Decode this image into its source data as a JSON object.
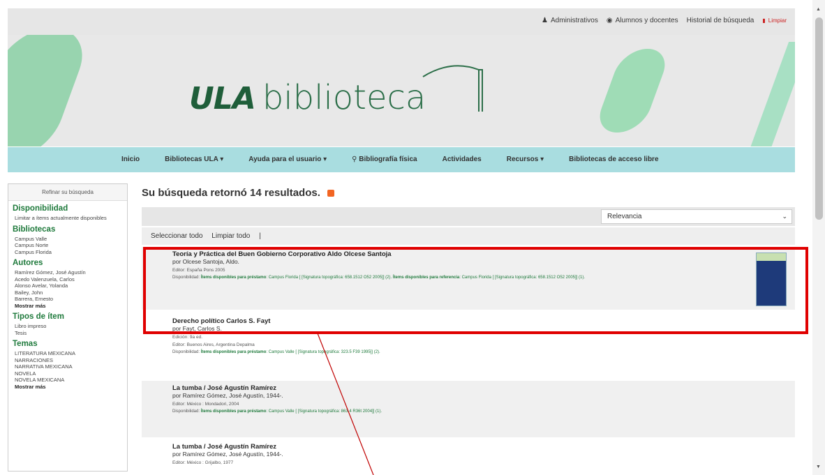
{
  "topbar": {
    "admin": "Administrativos",
    "students": "Alumnos y docentes",
    "history": "Historial de búsqueda",
    "clear": "Limpiar"
  },
  "banner": {
    "logo_mark": "ULA",
    "logo_text": "biblioteca"
  },
  "nav": [
    {
      "label": "Inicio"
    },
    {
      "label": "Bibliotecas ULA ▾"
    },
    {
      "label": "Ayuda para el usuario ▾"
    },
    {
      "label": "Bibliografía física"
    },
    {
      "label": "Actividades"
    },
    {
      "label": "Recursos ▾"
    },
    {
      "label": "Bibliotecas de acceso libre"
    }
  ],
  "sidebar": {
    "refine": "Refinar su búsqueda",
    "availability": {
      "heading": "Disponibilidad",
      "items": [
        "Limitar a ítems actualmente disponibles"
      ]
    },
    "libraries": {
      "heading": "Bibliotecas",
      "items": [
        "Campus Valle",
        "Campus Norte",
        "Campus Florida"
      ]
    },
    "authors": {
      "heading": "Autores",
      "items": [
        "Ramírez Gómez, José Agustín",
        "Acedo Valenzuela, Carlos",
        "Alonso Avelar, Yolanda",
        "Bailey, John",
        "Barrera, Ernesto"
      ],
      "more": "Mostrar más"
    },
    "types": {
      "heading": "Tipos de ítem",
      "items": [
        "Libro impreso",
        "Tesis"
      ]
    },
    "topics": {
      "heading": "Temas",
      "items": [
        "LITERATURA MEXICANA",
        "NARRACIONES",
        "NARRATIVA MEXICANA",
        "NOVELA",
        "NOVELA MEXICANA"
      ],
      "more": "Mostrar más"
    }
  },
  "main": {
    "heading": "Su búsqueda retornó 14 resultados.",
    "sort": "Relevancia",
    "select_all": "Seleccionar todo",
    "clear_all": "Limpiar todo",
    "results": [
      {
        "title": "Teoría y Práctica del Buen Gobierno Corporativo Aldo Olcese Santoja",
        "author": "por Olcese Santoja, Aldo.",
        "edition": "",
        "publisher": "Editor: España Pons 2005",
        "avail_label": "Disponibilidad:",
        "avail_loan": "Ítems disponibles para préstamo",
        "avail_loan_text": ": Campus Florida [ [Signatura topográfica: 658.1512 O52 2005]] (2).",
        "avail_ref": "Ítems disponibles para referencia",
        "avail_ref_text": ": Campus Florida [ [Signatura topográfica: 658.1512 O52 2005]] (1)."
      },
      {
        "title": "Derecho político Carlos S. Fayt",
        "author": "por Fayt, Carlos S.",
        "edition": "Edición: 9a ed.",
        "publisher": "Editor: Buenos Aires, Argentina Depalma",
        "avail_label": "Disponibilidad:",
        "avail_loan": "Ítems disponibles para préstamo",
        "avail_loan_text": ": Campus Valle [ [Signatura topográfica: 323.5 F39 1995]] (2).",
        "avail_ref": "",
        "avail_ref_text": ""
      },
      {
        "title": "La tumba / José Agustín Ramírez",
        "author": "por Ramírez Gómez, José Agustín, 1944-.",
        "edition": "",
        "publisher": "Editor: México : Mondadori, 2004",
        "avail_label": "Disponibilidad:",
        "avail_loan": "Ítems disponibles para préstamo",
        "avail_loan_text": ": Campus Valle [ [Signatura topográfica: 863.4 R36t 2004]] (1).",
        "avail_ref": "",
        "avail_ref_text": ""
      },
      {
        "title": "La tumba / José Agustín Ramírez",
        "author": "por Ramírez Gómez, José Agustín, 1944-.",
        "edition": "",
        "publisher": "Editor: México : Grijalbo, 1977",
        "avail_label": "",
        "avail_loan": "",
        "avail_loan_text": "",
        "avail_ref": "",
        "avail_ref_text": ""
      }
    ]
  },
  "colors": {
    "accent_green": "#1f7a3c",
    "nav_bg": "#a9dde0",
    "highlight": "#e00000"
  }
}
